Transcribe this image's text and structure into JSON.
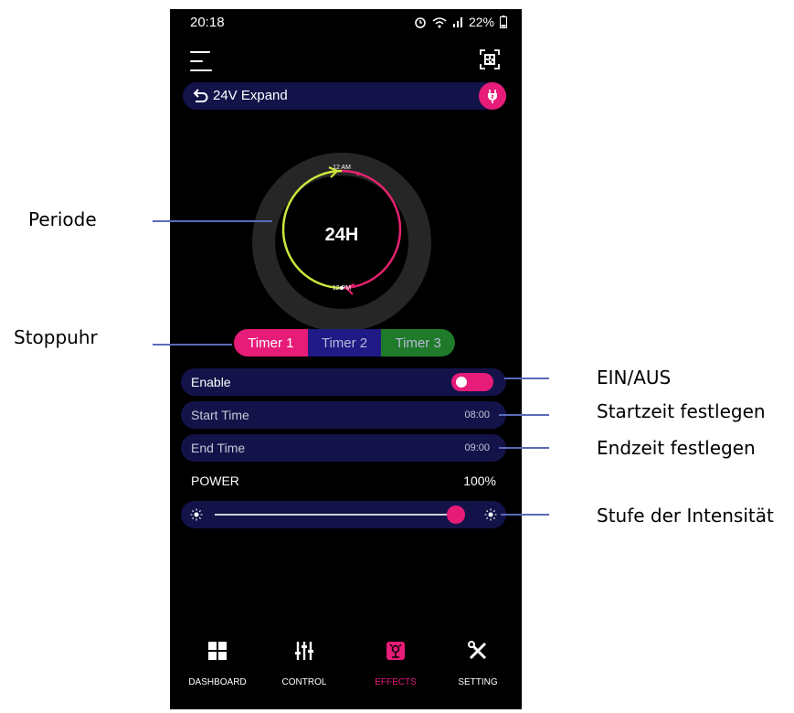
{
  "annotations": {
    "periode": "Periode",
    "stoppuhr": "Stoppuhr",
    "ein_aus": "EIN/AUS",
    "startzeit": "Startzeit festlegen",
    "endzeit": "Endzeit festlegen",
    "intensitaet": "Stufe der Intensität"
  },
  "status_bar": {
    "time": "20:18",
    "battery": "22%",
    "icons": [
      "alarm-icon",
      "wifi-icon",
      "signal-icon",
      "battery-icon"
    ]
  },
  "header": {
    "menu_icon": "hamburger-menu-icon",
    "qr_icon": "qr-code-icon"
  },
  "device": {
    "name": "24V Expand",
    "back_icon": "back-arrow-icon",
    "plug_icon": "plug-icon"
  },
  "dial": {
    "center_label": "24H",
    "top_label": "12 AM",
    "bottom_label": "12 PM"
  },
  "timers": [
    {
      "label": "Timer 1",
      "active": true,
      "color": "#e61c78"
    },
    {
      "label": "Timer 2",
      "active": false,
      "color": "#1f1a85"
    },
    {
      "label": "Timer 3",
      "active": false,
      "color": "#1f7a2a"
    }
  ],
  "enable": {
    "label": "Enable",
    "on": true
  },
  "start_time": {
    "label": "Start Time",
    "value": "08:00"
  },
  "end_time": {
    "label": "End Time",
    "value": "09:00"
  },
  "power": {
    "label": "POWER",
    "value": "100%",
    "level": 1.0
  },
  "nav": [
    {
      "label": "DASHBOARD",
      "icon": "dashboard-grid-icon",
      "active": false
    },
    {
      "label": "CONTROL",
      "icon": "sliders-icon",
      "active": false
    },
    {
      "label": "EFFECTS",
      "icon": "effects-icon",
      "active": true
    },
    {
      "label": "SETTING",
      "icon": "tools-icon",
      "active": false
    }
  ],
  "colors": {
    "accent": "#e61c78",
    "panel": "#13134a",
    "background": "#000000",
    "annotation_line": "#5b6ab8"
  }
}
